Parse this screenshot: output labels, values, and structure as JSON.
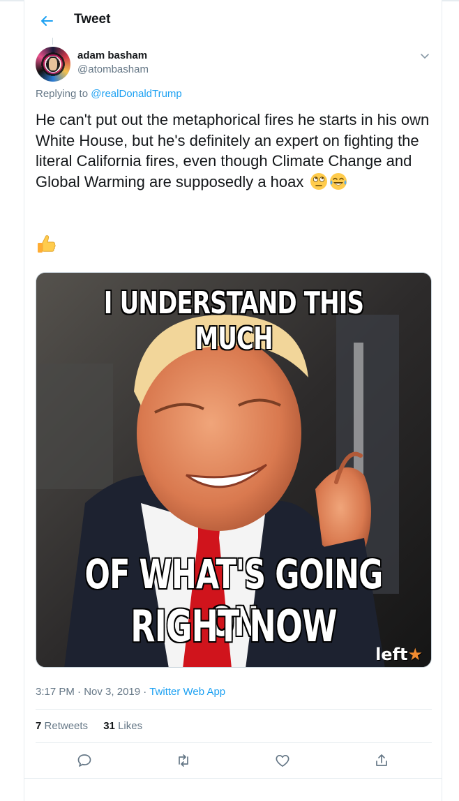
{
  "header": {
    "title": "Tweet",
    "back_icon": "arrow-left-icon"
  },
  "tweet": {
    "author": {
      "name": "adam basham",
      "handle": "@atombasham"
    },
    "replying_prefix": "Replying to",
    "replying_to": "@realDonaldTrump",
    "text": "He can't put out the metaphorical fires he starts in his own White House, but he's definitely an expert on fighting the literal California fires, even though Climate Change and Global Warming are supposedly a hoax",
    "emojis": [
      "face-with-rolling-eyes",
      "face-with-tears-of-joy"
    ],
    "reaction_emoji": "thumbs-up",
    "media": {
      "top_caption": "I UNDERSTAND THIS MUCH",
      "bottom_caption_1": "OF WHAT'S GOING ON",
      "bottom_caption_2": "RIGHT NOW",
      "watermark": "left"
    },
    "time": "3:17 PM",
    "date": "Nov 3, 2019",
    "source": "Twitter Web App",
    "retweets": "7",
    "retweets_label": "Retweets",
    "likes": "31",
    "likes_label": "Likes"
  },
  "actions": [
    "reply-icon",
    "retweet-icon",
    "like-icon",
    "share-icon"
  ],
  "colors": {
    "accent": "#1da1f2",
    "secondary_text": "#657786",
    "border": "#e6ecf0"
  }
}
